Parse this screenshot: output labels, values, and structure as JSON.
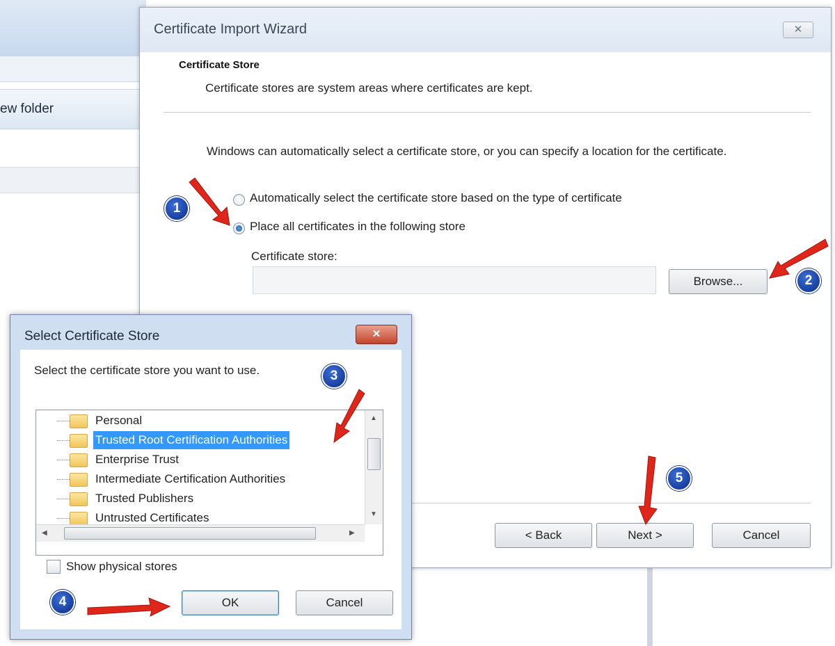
{
  "background_window": {
    "toolbar_text": "ew folder"
  },
  "wizard": {
    "title": "Certificate Import Wizard",
    "close_label": "✕",
    "heading": "Certificate Store",
    "description": "Certificate stores are system areas where certificates are kept.",
    "body_text": "Windows can automatically select a certificate store, or you can specify a location for the certificate.",
    "radio_auto_label": "Automatically select the certificate store based on the type of certificate",
    "radio_place_label": "Place all certificates in the following store",
    "radio_selected": "place",
    "store_label": "Certificate store:",
    "store_value": "",
    "browse_label": "Browse...",
    "back_label": "< Back",
    "next_label": "Next >",
    "cancel_label": "Cancel"
  },
  "select_store_dialog": {
    "title": "Select Certificate Store",
    "close_label": "✕",
    "prompt": "Select the certificate store you want to use.",
    "stores": [
      "Personal",
      "Trusted Root Certification Authorities",
      "Enterprise Trust",
      "Intermediate Certification Authorities",
      "Trusted Publishers",
      "Untrusted Certificates"
    ],
    "selected_index": 1,
    "show_physical_label": "Show physical stores",
    "ok_label": "OK",
    "cancel_label": "Cancel"
  },
  "annotations": {
    "steps": [
      "1",
      "2",
      "3",
      "4",
      "5"
    ],
    "arrow_color": "#e0261b",
    "badge_color": "#0a2a8a"
  },
  "colors": {
    "selection": "#3399ff",
    "dialog_frame": "#cfdff1",
    "close_button_red": "#c4432c"
  }
}
